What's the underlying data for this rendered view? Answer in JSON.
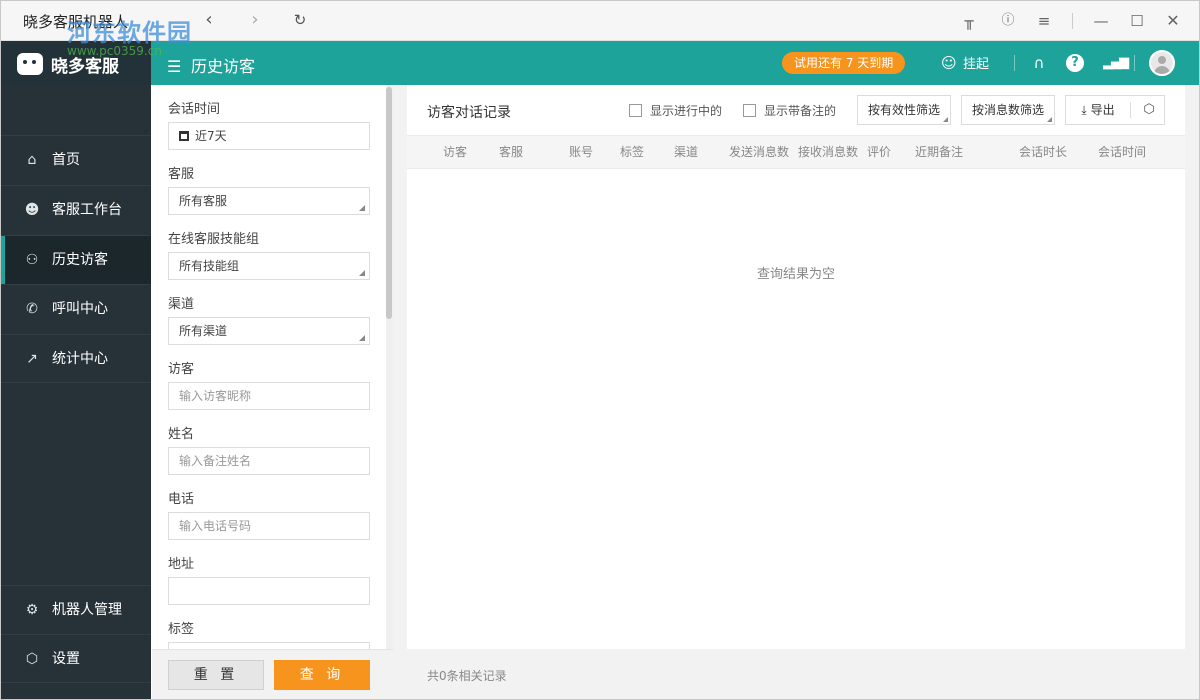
{
  "window": {
    "title": "晓多客服机器人",
    "watermark_main": "河东软件园",
    "watermark_sub": "www.pc0359.cn"
  },
  "header": {
    "brand": "晓多客服",
    "page_title": "历史访客",
    "trial_badge": "试用还有 7 天到期",
    "hang_label": "挂起"
  },
  "sidebar": {
    "items": [
      {
        "label": "首页",
        "icon": "home-icon"
      },
      {
        "label": "客服工作台",
        "icon": "agent-icon"
      },
      {
        "label": "历史访客",
        "icon": "visitors-icon",
        "active": true
      },
      {
        "label": "呼叫中心",
        "icon": "phone-icon"
      },
      {
        "label": "统计中心",
        "icon": "chart-icon"
      }
    ],
    "bottom_items": [
      {
        "label": "机器人管理",
        "icon": "robot-icon"
      },
      {
        "label": "设置",
        "icon": "settings-icon"
      }
    ]
  },
  "filter": {
    "session_time": {
      "label": "会话时间",
      "value": "近7天"
    },
    "agent": {
      "label": "客服",
      "value": "所有客服"
    },
    "skill_group": {
      "label": "在线客服技能组",
      "value": "所有技能组"
    },
    "channel": {
      "label": "渠道",
      "value": "所有渠道"
    },
    "visitor": {
      "label": "访客",
      "placeholder": "输入访客昵称"
    },
    "name": {
      "label": "姓名",
      "placeholder": "输入备注姓名"
    },
    "phone": {
      "label": "电话",
      "placeholder": "输入电话号码"
    },
    "address": {
      "label": "地址",
      "value": ""
    },
    "tags": {
      "label": "标签"
    },
    "reset_label": "重 置",
    "query_label": "查 询"
  },
  "records": {
    "title": "访客对话记录",
    "show_ongoing": "显示进行中的",
    "show_with_notes": "显示带备注的",
    "filter_validity": "按有效性筛选",
    "filter_msg_count": "按消息数筛选",
    "export_label": "导出",
    "columns": [
      "访客",
      "客服",
      "账号",
      "标签",
      "渠道",
      "发送消息数",
      "接收消息数",
      "评价",
      "近期备注",
      "会话时长",
      "会话时间"
    ],
    "empty_text": "查询结果为空",
    "total_text": "共0条相关记录"
  },
  "colors": {
    "accent": "#1ea39a",
    "sidebar": "#263238",
    "orange": "#f7941d"
  }
}
